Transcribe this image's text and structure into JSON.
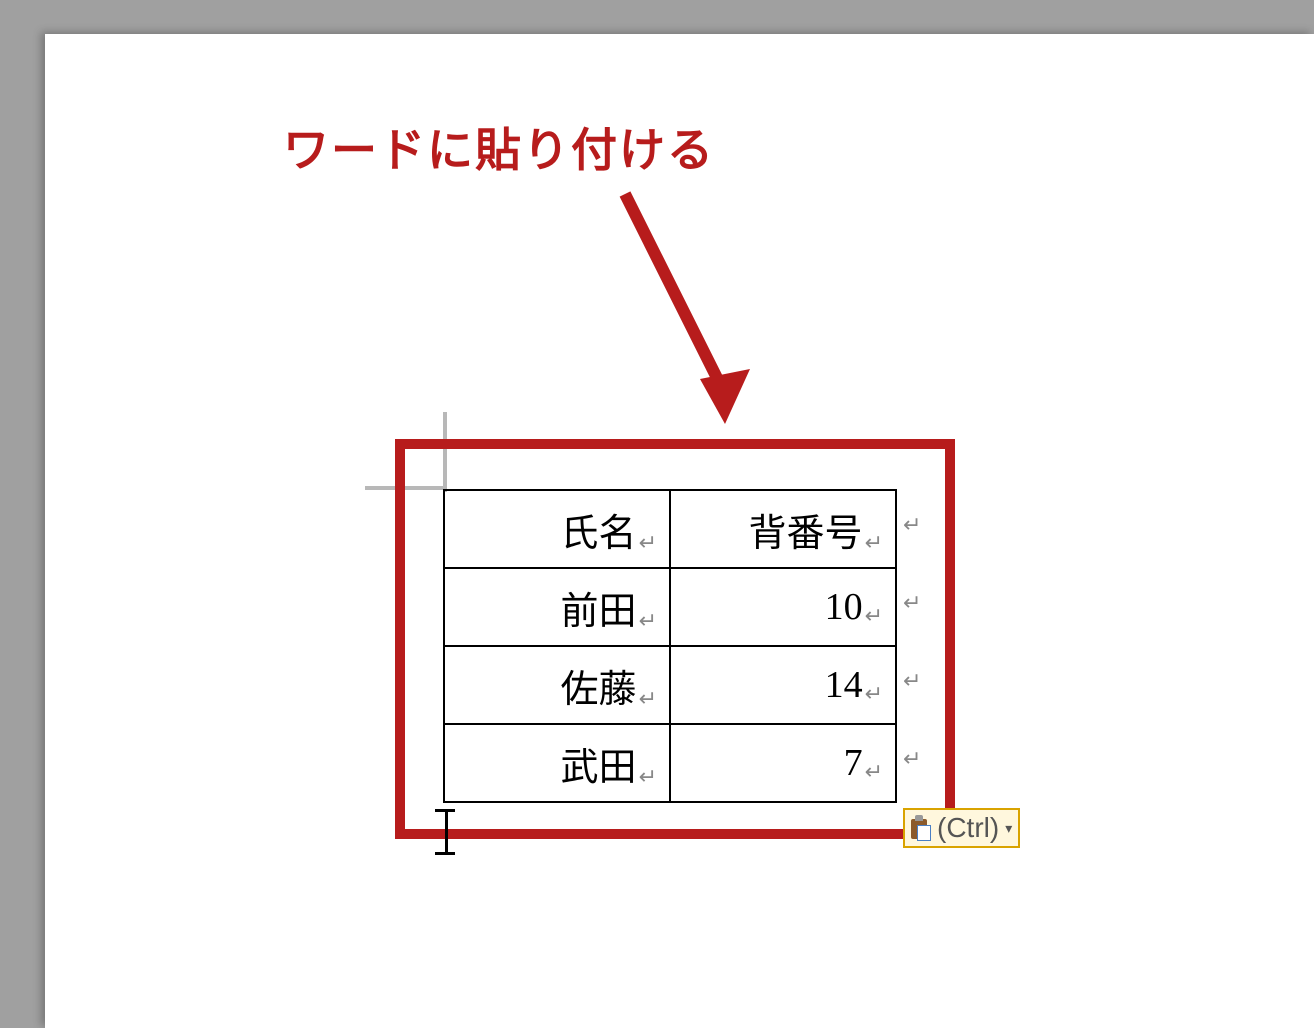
{
  "annotation": {
    "title": "ワードに貼り付ける"
  },
  "table": {
    "headers": [
      "氏名",
      "背番号"
    ],
    "rows": [
      {
        "name": "前田",
        "number": "10"
      },
      {
        "name": "佐藤",
        "number": "14"
      },
      {
        "name": "武田",
        "number": "7"
      }
    ]
  },
  "paragraph_mark": "↵",
  "paste_options": {
    "label": "(Ctrl)"
  }
}
